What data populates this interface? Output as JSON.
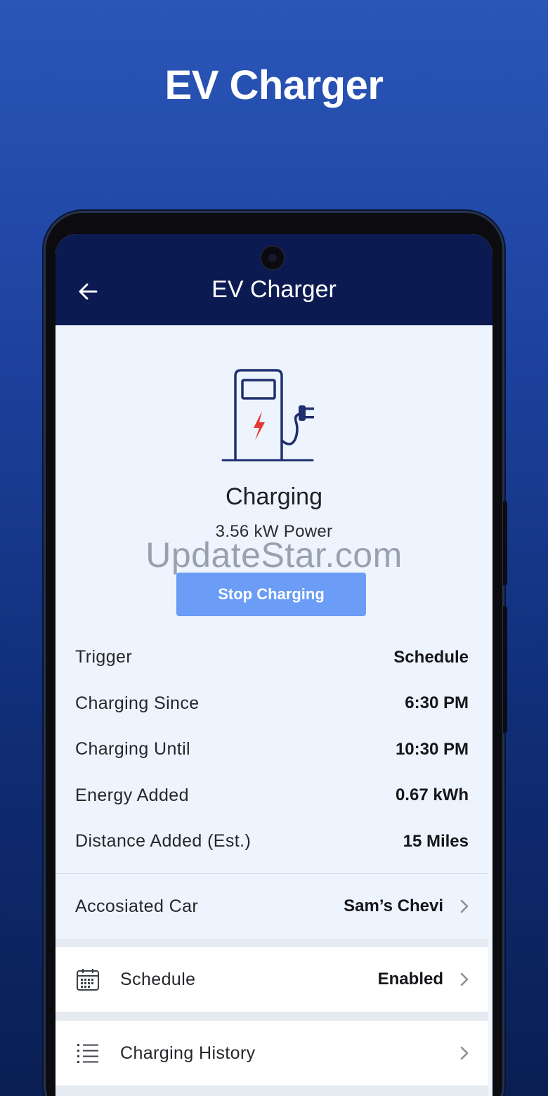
{
  "promo": {
    "title": "EV Charger"
  },
  "appbar": {
    "title": "EV Charger",
    "back_icon": "arrow-left-icon"
  },
  "status": {
    "title": "Charging",
    "power": "3.56 kW Power",
    "icon": "charging-station-icon",
    "accent": "#e53935",
    "line_color": "#1e2f6e"
  },
  "watermark": "UpdateStar.com",
  "actions": {
    "stop_label": "Stop Charging",
    "stop_color": "#6b9cf6"
  },
  "details": [
    {
      "label": "Trigger",
      "value": "Schedule"
    },
    {
      "label": "Charging Since",
      "value": "6:30 PM"
    },
    {
      "label": "Charging Until",
      "value": "10:30 PM"
    },
    {
      "label": "Energy Added",
      "value": "0.67 kWh"
    },
    {
      "label": "Distance Added (Est.)",
      "value": "15 Miles"
    }
  ],
  "associated_car": {
    "label": "Accosiated Car",
    "value": "Sam’s Chevi"
  },
  "schedule": {
    "label": "Schedule",
    "value": "Enabled",
    "icon": "calendar-icon"
  },
  "history": {
    "label": "Charging History",
    "icon": "list-icon"
  },
  "colors": {
    "appbar": "#0c1a52",
    "background_top": "#2a56b8",
    "background_bottom": "#0a1e52"
  }
}
